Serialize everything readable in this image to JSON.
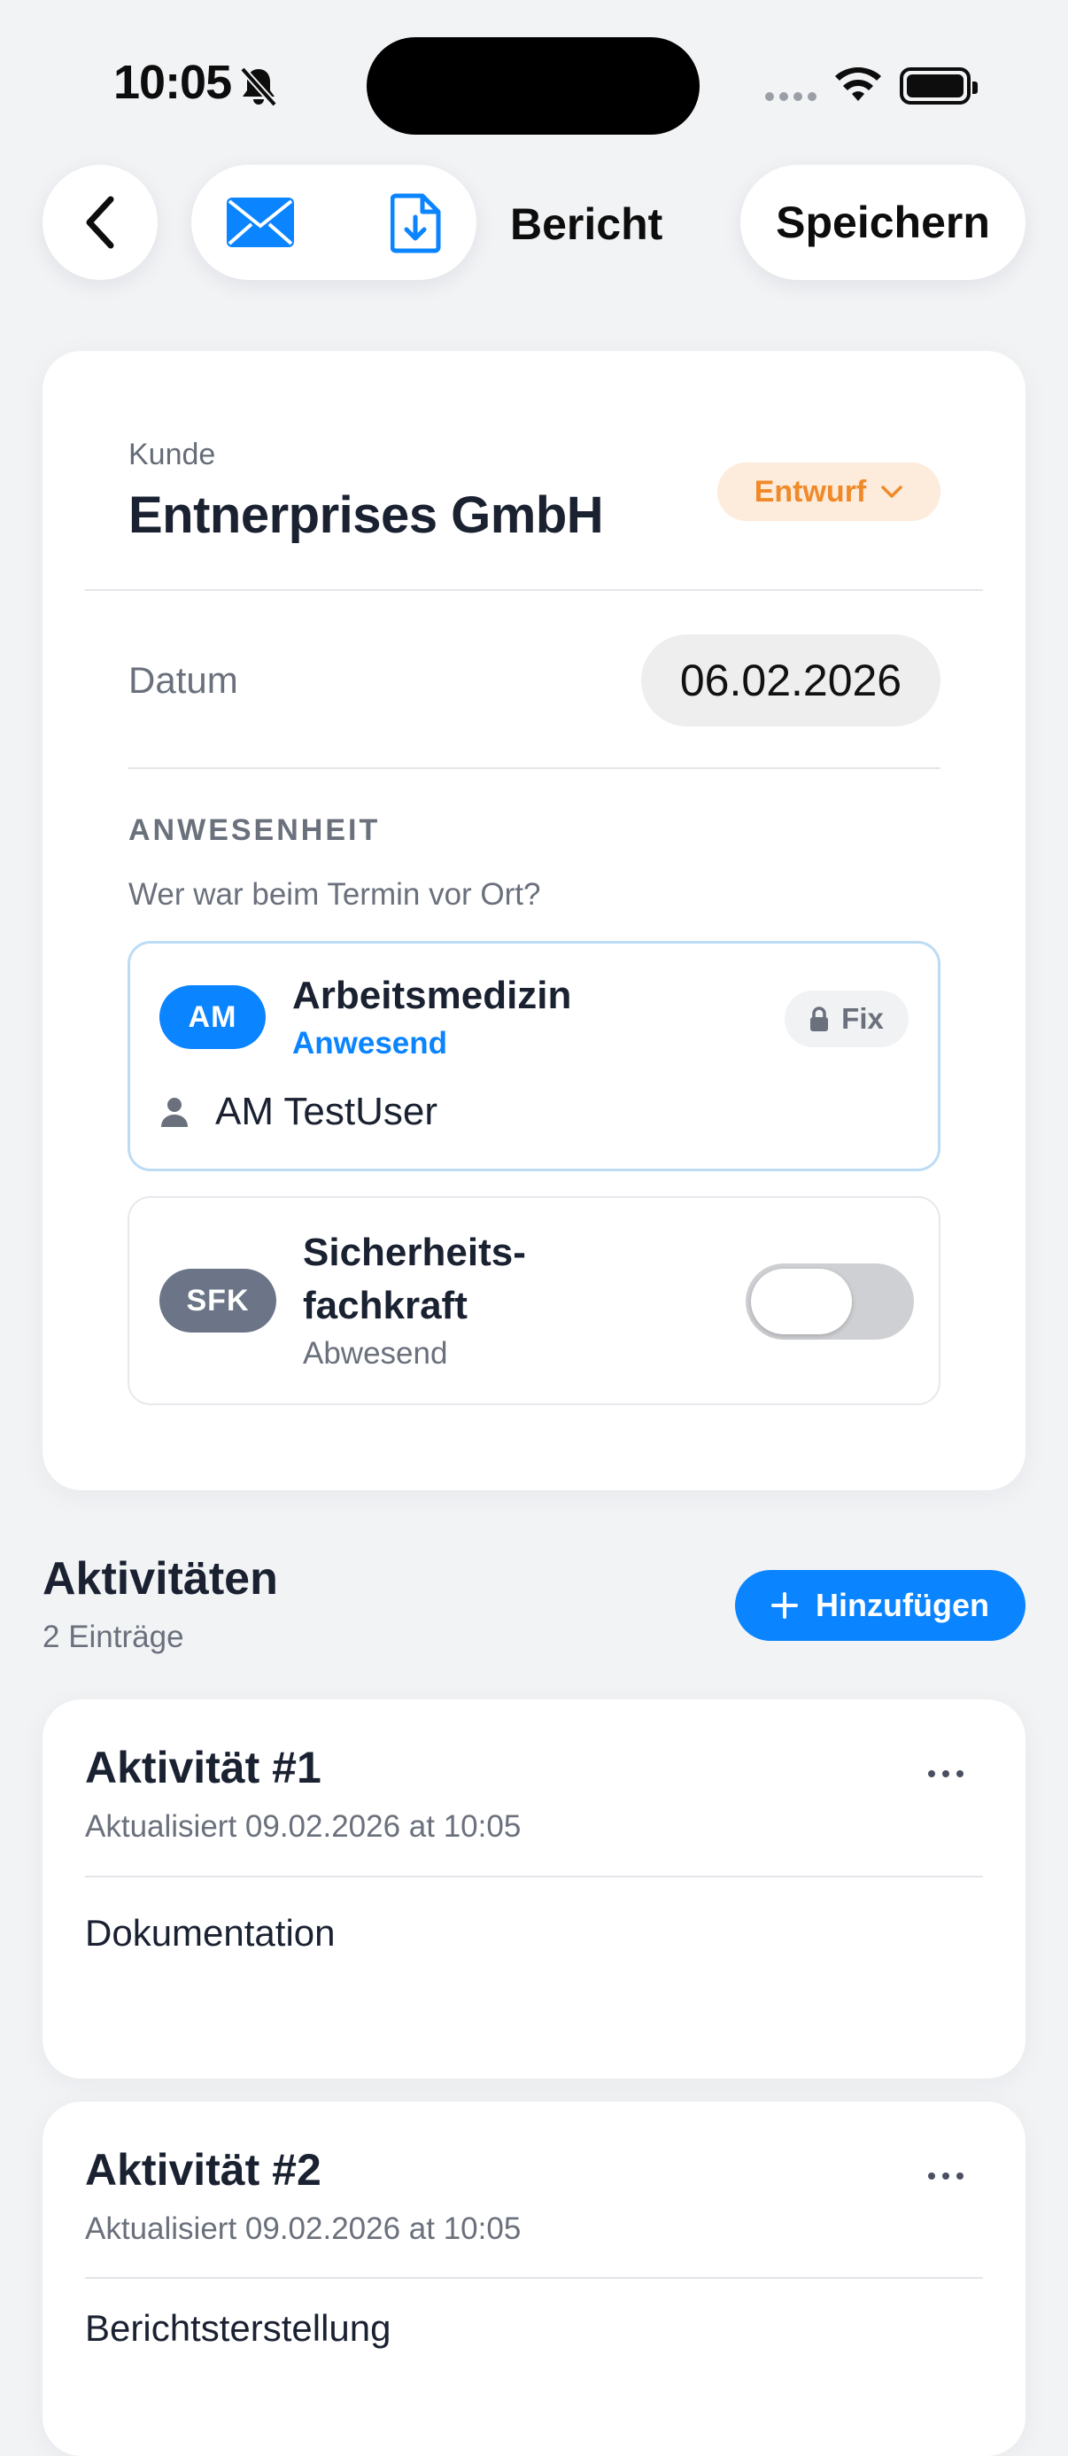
{
  "status_bar": {
    "time": "10:05"
  },
  "nav": {
    "title": "Bericht",
    "save_label": "Speichern"
  },
  "report": {
    "customer_label": "Kunde",
    "customer_name": "Entnerprises GmbH",
    "status": "Entwurf",
    "date_label": "Datum",
    "date_value": "06.02.2026",
    "attendance": {
      "section_label": "ANWESENHEIT",
      "question": "Wer war beim Termin vor Ort?",
      "roles": [
        {
          "badge": "AM",
          "title": "Arbeitsmedizin",
          "status": "Anwesend",
          "lock_label": "Fix",
          "user": "AM TestUser"
        },
        {
          "badge": "SFK",
          "title_line1": "Sicherheits-",
          "title_line2": "fachkraft",
          "status": "Abwesend",
          "toggle_on": false
        }
      ]
    }
  },
  "activities": {
    "title": "Aktivitäten",
    "count": "2 Einträge",
    "add_label": "Hinzufügen",
    "items": [
      {
        "name": "Aktivität #1",
        "updated": "Aktualisiert 09.02.2026 at 10:05",
        "field": "Dokumentation"
      },
      {
        "name": "Aktivität #2",
        "updated": "Aktualisiert 09.02.2026 at 10:05",
        "field": "Berichtsterstellung"
      }
    ]
  },
  "colors": {
    "accent": "#0a84ff",
    "draft": "#f08a28",
    "background": "#f2f3f5"
  }
}
